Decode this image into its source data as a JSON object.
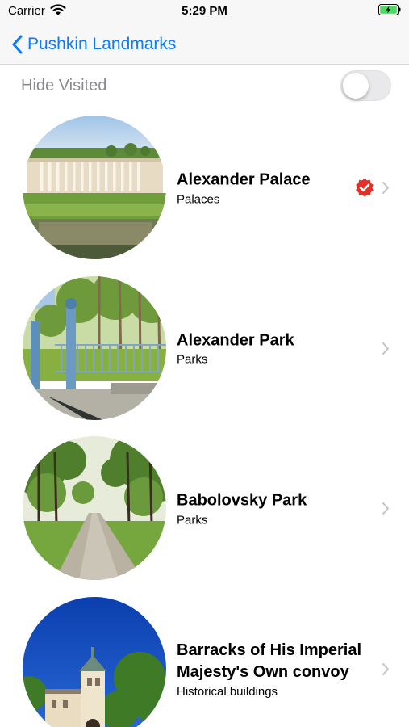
{
  "status_bar": {
    "carrier": "Carrier",
    "time": "5:29 PM",
    "wifi_icon": "wifi-icon",
    "battery_icon": "battery-charging-icon",
    "battery_color": "#4cd964"
  },
  "nav": {
    "back_label": "Pushkin Landmarks",
    "back_icon": "chevron-left-icon",
    "accent_color": "#0a7aff"
  },
  "filter": {
    "label": "Hide Visited",
    "toggle_on": false
  },
  "landmarks": [
    {
      "name": "Alexander Palace",
      "category": "Palaces",
      "visited": true,
      "image": "palace-photo"
    },
    {
      "name": "Alexander Park",
      "category": "Parks",
      "visited": false,
      "image": "park-gate-photo"
    },
    {
      "name": "Babolovsky Park",
      "category": "Parks",
      "visited": false,
      "image": "forest-path-photo"
    },
    {
      "name": "Barracks of His Imperial Majesty's Own convoy",
      "category": "Historical buildings",
      "visited": false,
      "image": "barracks-tower-photo"
    }
  ],
  "visited_badge": {
    "icon": "checkmark-seal-icon",
    "color": "#e63027"
  }
}
